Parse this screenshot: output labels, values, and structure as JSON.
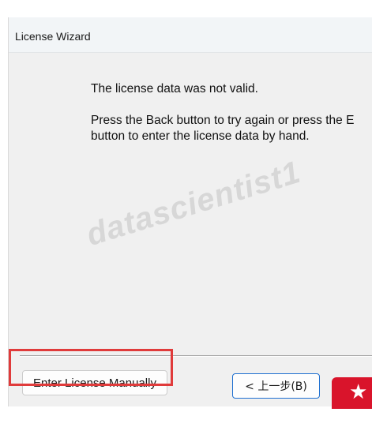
{
  "window": {
    "title": "License Wizard"
  },
  "message": {
    "line1": "The license data was not valid.",
    "line2": "Press the Back button to try again or press the E",
    "line3": "button to enter the license data by hand."
  },
  "watermark": {
    "text": "datascientist1"
  },
  "buttons": {
    "enter_manually_label": "Enter License Manually",
    "back_label": "< 上一步(B)"
  },
  "colors": {
    "highlight": "#e03b3b",
    "back_focus_border": "#1e6fd0",
    "badge": "#d9142b"
  },
  "icons": {
    "badge": "star-icon"
  }
}
